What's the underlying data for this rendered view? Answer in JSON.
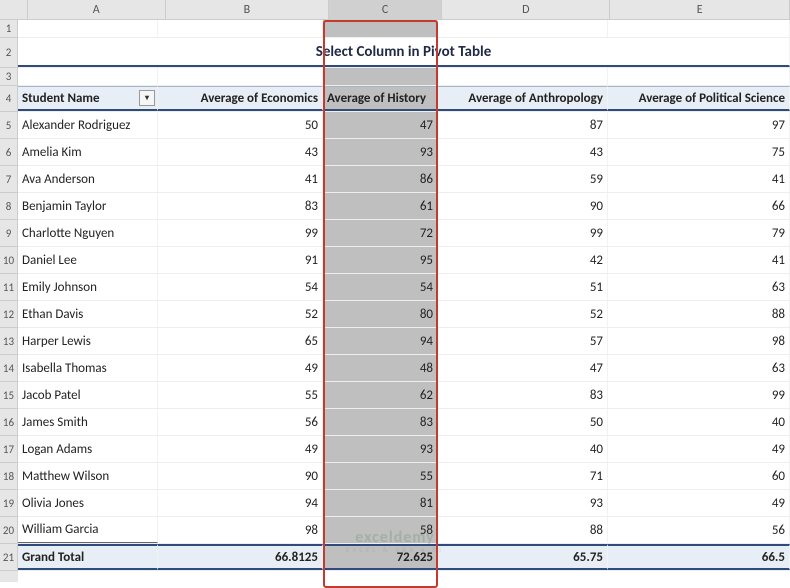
{
  "chart_data": {
    "type": "table",
    "title": "Select Column in Pivot Table",
    "columns": [
      "Student Name",
      "Average of Economics",
      "Average of History",
      "Average of Anthropology",
      "Average of Political Science"
    ],
    "rows": [
      [
        "Alexander Rodriguez",
        50,
        47,
        87,
        97
      ],
      [
        "Amelia Kim",
        43,
        93,
        43,
        75
      ],
      [
        "Ava Anderson",
        41,
        86,
        59,
        41
      ],
      [
        "Benjamin Taylor",
        83,
        61,
        90,
        66
      ],
      [
        "Charlotte Nguyen",
        99,
        72,
        99,
        79
      ],
      [
        "Daniel Lee",
        91,
        95,
        42,
        41
      ],
      [
        "Emily Johnson",
        54,
        54,
        51,
        63
      ],
      [
        "Ethan Davis",
        52,
        80,
        52,
        88
      ],
      [
        "Harper Lewis",
        65,
        94,
        57,
        98
      ],
      [
        "Isabella Thomas",
        49,
        48,
        47,
        63
      ],
      [
        "Jacob Patel",
        55,
        62,
        83,
        99
      ],
      [
        "James Smith",
        56,
        83,
        50,
        40
      ],
      [
        "Logan Adams",
        49,
        93,
        40,
        49
      ],
      [
        "Matthew Wilson",
        90,
        55,
        71,
        60
      ],
      [
        "Olivia Jones",
        94,
        81,
        93,
        49
      ],
      [
        "William Garcia",
        98,
        58,
        88,
        56
      ]
    ],
    "totals": [
      "Grand Total",
      66.8125,
      72.625,
      65.75,
      66.5
    ]
  },
  "cols": {
    "A": "A",
    "B": "B",
    "C": "C",
    "D": "D",
    "E": "E"
  },
  "rownums": [
    "1",
    "2",
    "3",
    "4",
    "5",
    "6",
    "7",
    "8",
    "9",
    "10",
    "11",
    "12",
    "13",
    "14",
    "15",
    "16",
    "17",
    "18",
    "19",
    "20",
    "21"
  ],
  "title": "Select Column in Pivot Table",
  "headers": {
    "name": "Student Name",
    "econ": "Average of Economics",
    "hist": "Average of History",
    "anth": "Average of Anthropology",
    "poli": "Average of Political Science"
  },
  "rows": [
    {
      "n": "Alexander Rodriguez",
      "b": "50",
      "c": "47",
      "d": "87",
      "e": "97"
    },
    {
      "n": "Amelia Kim",
      "b": "43",
      "c": "93",
      "d": "43",
      "e": "75"
    },
    {
      "n": "Ava Anderson",
      "b": "41",
      "c": "86",
      "d": "59",
      "e": "41"
    },
    {
      "n": "Benjamin Taylor",
      "b": "83",
      "c": "61",
      "d": "90",
      "e": "66"
    },
    {
      "n": "Charlotte Nguyen",
      "b": "99",
      "c": "72",
      "d": "99",
      "e": "79"
    },
    {
      "n": "Daniel Lee",
      "b": "91",
      "c": "95",
      "d": "42",
      "e": "41"
    },
    {
      "n": "Emily Johnson",
      "b": "54",
      "c": "54",
      "d": "51",
      "e": "63"
    },
    {
      "n": "Ethan Davis",
      "b": "52",
      "c": "80",
      "d": "52",
      "e": "88"
    },
    {
      "n": "Harper Lewis",
      "b": "65",
      "c": "94",
      "d": "57",
      "e": "98"
    },
    {
      "n": "Isabella Thomas",
      "b": "49",
      "c": "48",
      "d": "47",
      "e": "63"
    },
    {
      "n": "Jacob Patel",
      "b": "55",
      "c": "62",
      "d": "83",
      "e": "99"
    },
    {
      "n": "James Smith",
      "b": "56",
      "c": "83",
      "d": "50",
      "e": "40"
    },
    {
      "n": "Logan Adams",
      "b": "49",
      "c": "93",
      "d": "40",
      "e": "49"
    },
    {
      "n": "Matthew Wilson",
      "b": "90",
      "c": "55",
      "d": "71",
      "e": "60"
    },
    {
      "n": "Olivia Jones",
      "b": "94",
      "c": "81",
      "d": "93",
      "e": "49"
    },
    {
      "n": "William Garcia",
      "b": "98",
      "c": "58",
      "d": "88",
      "e": "56"
    }
  ],
  "total": {
    "label": "Grand Total",
    "b": "66.8125",
    "c": "72.625",
    "d": "65.75",
    "e": "66.5"
  },
  "watermark": {
    "main": "exceldemy",
    "sub": "EXCEL & VBA • BI"
  },
  "filter_glyph": "▾"
}
